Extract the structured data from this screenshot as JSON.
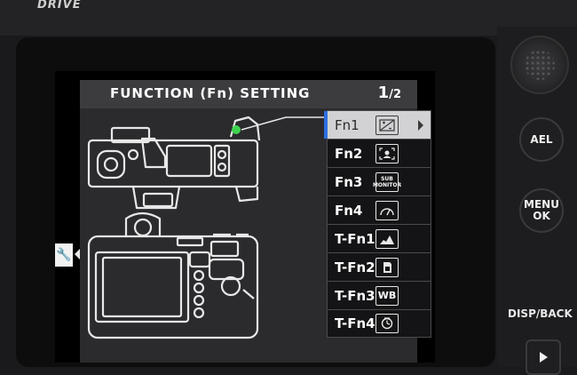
{
  "camera": {
    "top_label": "DRIVE",
    "buttons": {
      "ael": "AEL",
      "menu_ok": "MENU\nOK",
      "disp_back": "DISP/BACK"
    }
  },
  "screen": {
    "title": "FUNCTION (Fn) SETTING",
    "page": {
      "current": "1",
      "total": "2"
    },
    "menu_items": [
      {
        "label": "Fn1",
        "icon": "exposure-comp-icon",
        "icon_text": "",
        "selected": true
      },
      {
        "label": "Fn2",
        "icon": "face-detect-icon",
        "icon_text": "",
        "selected": false
      },
      {
        "label": "Fn3",
        "icon": "sub-monitor-icon",
        "icon_text": "SUB\nMONITOR",
        "selected": false
      },
      {
        "label": "Fn4",
        "icon": "gauge-icon",
        "icon_text": "",
        "selected": false
      },
      {
        "label": "T-Fn1",
        "icon": "histogram-icon",
        "icon_text": "",
        "selected": false
      },
      {
        "label": "T-Fn2",
        "icon": "card-slot-icon",
        "icon_text": "",
        "selected": false
      },
      {
        "label": "T-Fn3",
        "icon": "white-balance-icon",
        "icon_text": "WB",
        "selected": false
      },
      {
        "label": "T-Fn4",
        "icon": "self-timer-icon",
        "icon_text": "",
        "selected": false
      }
    ],
    "colors": {
      "selection_accent": "#2d6fe0",
      "highlight_dot": "#3fd34f"
    }
  }
}
